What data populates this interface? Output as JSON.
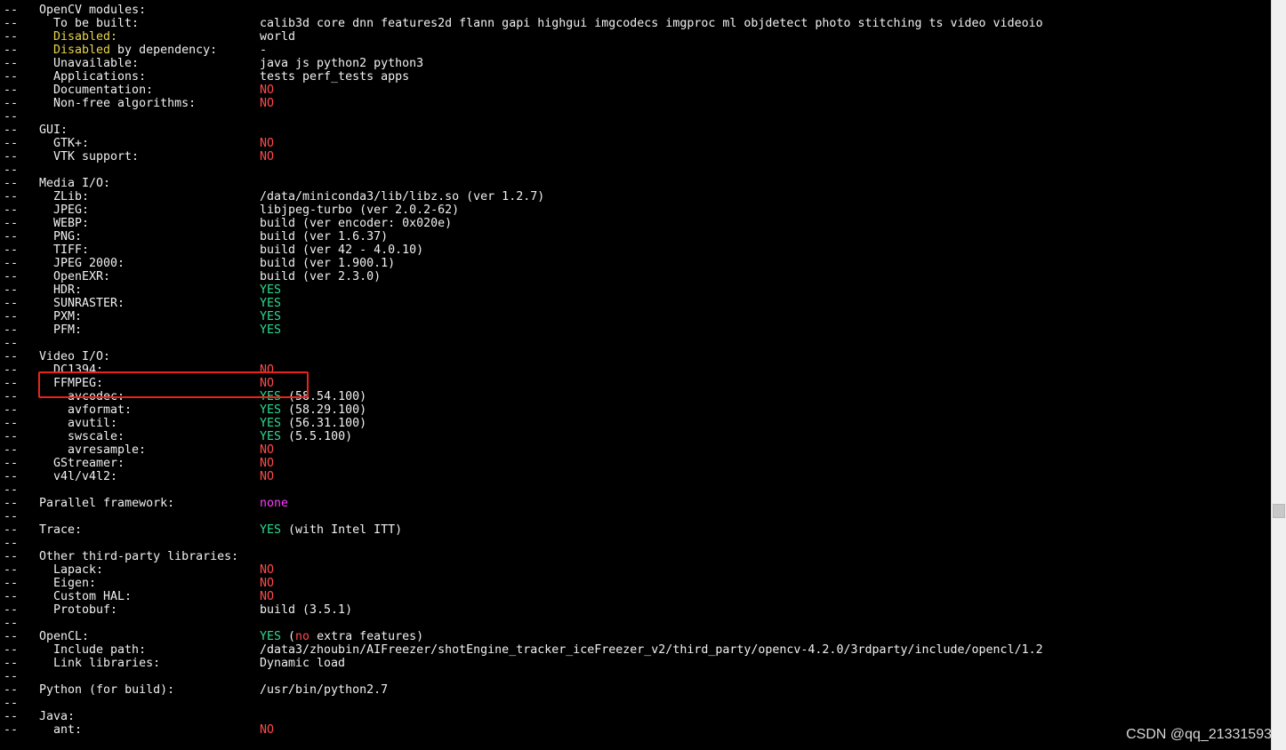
{
  "terminal": {
    "prefix": "--",
    "lines": [
      {
        "label": "OpenCV modules:",
        "indent": 1,
        "value": []
      },
      {
        "label": "To be built:",
        "indent": 2,
        "value": [
          {
            "t": "calib3d core dnn features2d flann gapi highgui imgcodecs imgproc ml objdetect photo stitching ts video videoio",
            "c": "white"
          }
        ]
      },
      {
        "labelParts": [
          {
            "t": "Disabled:",
            "c": "yellow"
          }
        ],
        "indent": 2,
        "value": [
          {
            "t": "world",
            "c": "white"
          }
        ]
      },
      {
        "labelParts": [
          {
            "t": "Disabled",
            "c": "yellow"
          },
          {
            "t": " by dependency:",
            "c": "white"
          }
        ],
        "indent": 2,
        "value": [
          {
            "t": "-",
            "c": "white"
          }
        ]
      },
      {
        "label": "Unavailable:",
        "indent": 2,
        "value": [
          {
            "t": "java js python2 python3",
            "c": "white"
          }
        ]
      },
      {
        "label": "Applications:",
        "indent": 2,
        "value": [
          {
            "t": "tests perf_tests apps",
            "c": "white"
          }
        ]
      },
      {
        "label": "Documentation:",
        "indent": 2,
        "value": [
          {
            "t": "NO",
            "c": "red"
          }
        ]
      },
      {
        "label": "Non-free algorithms:",
        "indent": 2,
        "value": [
          {
            "t": "NO",
            "c": "red"
          }
        ]
      },
      {
        "label": "",
        "indent": 0,
        "value": []
      },
      {
        "label": "GUI:",
        "indent": 1,
        "value": []
      },
      {
        "label": "GTK+:",
        "indent": 2,
        "value": [
          {
            "t": "NO",
            "c": "red"
          }
        ]
      },
      {
        "label": "VTK support:",
        "indent": 2,
        "value": [
          {
            "t": "NO",
            "c": "red"
          }
        ]
      },
      {
        "label": "",
        "indent": 0,
        "value": []
      },
      {
        "label": "Media I/O:",
        "indent": 1,
        "value": []
      },
      {
        "label": "ZLib:",
        "indent": 2,
        "value": [
          {
            "t": "/data/miniconda3/lib/libz.so (ver 1.2.7)",
            "c": "white"
          }
        ]
      },
      {
        "label": "JPEG:",
        "indent": 2,
        "value": [
          {
            "t": "libjpeg-turbo (ver 2.0.2-62)",
            "c": "white"
          }
        ]
      },
      {
        "label": "WEBP:",
        "indent": 2,
        "value": [
          {
            "t": "build (ver encoder: 0x020e)",
            "c": "white"
          }
        ]
      },
      {
        "label": "PNG:",
        "indent": 2,
        "value": [
          {
            "t": "build (ver 1.6.37)",
            "c": "white"
          }
        ]
      },
      {
        "label": "TIFF:",
        "indent": 2,
        "value": [
          {
            "t": "build (ver 42 - 4.0.10)",
            "c": "white"
          }
        ]
      },
      {
        "label": "JPEG 2000:",
        "indent": 2,
        "value": [
          {
            "t": "build (ver 1.900.1)",
            "c": "white"
          }
        ]
      },
      {
        "label": "OpenEXR:",
        "indent": 2,
        "value": [
          {
            "t": "build (ver 2.3.0)",
            "c": "white"
          }
        ]
      },
      {
        "label": "HDR:",
        "indent": 2,
        "value": [
          {
            "t": "YES",
            "c": "green"
          }
        ]
      },
      {
        "label": "SUNRASTER:",
        "indent": 2,
        "value": [
          {
            "t": "YES",
            "c": "green"
          }
        ]
      },
      {
        "label": "PXM:",
        "indent": 2,
        "value": [
          {
            "t": "YES",
            "c": "green"
          }
        ]
      },
      {
        "label": "PFM:",
        "indent": 2,
        "value": [
          {
            "t": "YES",
            "c": "green"
          }
        ]
      },
      {
        "label": "",
        "indent": 0,
        "value": []
      },
      {
        "label": "Video I/O:",
        "indent": 1,
        "value": []
      },
      {
        "label": "DC1394:",
        "indent": 2,
        "value": [
          {
            "t": "NO",
            "c": "red"
          }
        ]
      },
      {
        "label": "FFMPEG:",
        "indent": 2,
        "value": [
          {
            "t": "NO",
            "c": "red"
          }
        ]
      },
      {
        "label": "avcodec:",
        "indent": 3,
        "value": [
          {
            "t": "YES",
            "c": "green"
          },
          {
            "t": " (58.54.100)",
            "c": "white"
          }
        ]
      },
      {
        "label": "avformat:",
        "indent": 3,
        "value": [
          {
            "t": "YES",
            "c": "green"
          },
          {
            "t": " (58.29.100)",
            "c": "white"
          }
        ]
      },
      {
        "label": "avutil:",
        "indent": 3,
        "value": [
          {
            "t": "YES",
            "c": "green"
          },
          {
            "t": " (56.31.100)",
            "c": "white"
          }
        ]
      },
      {
        "label": "swscale:",
        "indent": 3,
        "value": [
          {
            "t": "YES",
            "c": "green"
          },
          {
            "t": " (5.5.100)",
            "c": "white"
          }
        ]
      },
      {
        "label": "avresample:",
        "indent": 3,
        "value": [
          {
            "t": "NO",
            "c": "red"
          }
        ]
      },
      {
        "label": "GStreamer:",
        "indent": 2,
        "value": [
          {
            "t": "NO",
            "c": "red"
          }
        ]
      },
      {
        "label": "v4l/v4l2:",
        "indent": 2,
        "value": [
          {
            "t": "NO",
            "c": "red"
          }
        ]
      },
      {
        "label": "",
        "indent": 0,
        "value": []
      },
      {
        "label": "Parallel framework:",
        "indent": 1,
        "value": [
          {
            "t": "none",
            "c": "magenta"
          }
        ]
      },
      {
        "label": "",
        "indent": 0,
        "value": []
      },
      {
        "label": "Trace:",
        "indent": 1,
        "value": [
          {
            "t": "YES",
            "c": "green"
          },
          {
            "t": " (with Intel ITT)",
            "c": "white"
          }
        ]
      },
      {
        "label": "",
        "indent": 0,
        "value": []
      },
      {
        "label": "Other third-party libraries:",
        "indent": 1,
        "value": []
      },
      {
        "label": "Lapack:",
        "indent": 2,
        "value": [
          {
            "t": "NO",
            "c": "red"
          }
        ]
      },
      {
        "label": "Eigen:",
        "indent": 2,
        "value": [
          {
            "t": "NO",
            "c": "red"
          }
        ]
      },
      {
        "label": "Custom HAL:",
        "indent": 2,
        "value": [
          {
            "t": "NO",
            "c": "red"
          }
        ]
      },
      {
        "label": "Protobuf:",
        "indent": 2,
        "value": [
          {
            "t": "build (3.5.1)",
            "c": "white"
          }
        ]
      },
      {
        "label": "",
        "indent": 0,
        "value": []
      },
      {
        "label": "OpenCL:",
        "indent": 1,
        "value": [
          {
            "t": "YES",
            "c": "green"
          },
          {
            "t": " (",
            "c": "white"
          },
          {
            "t": "no",
            "c": "red"
          },
          {
            "t": " extra features)",
            "c": "white"
          }
        ]
      },
      {
        "label": "Include path:",
        "indent": 2,
        "value": [
          {
            "t": "/data3/zhoubin/AIFreezer/shotEngine_tracker_iceFreezer_v2/third_party/opencv-4.2.0/3rdparty/include/opencl/1.2",
            "c": "white"
          }
        ]
      },
      {
        "label": "Link libraries:",
        "indent": 2,
        "value": [
          {
            "t": "Dynamic load",
            "c": "white"
          }
        ]
      },
      {
        "label": "",
        "indent": 0,
        "value": []
      },
      {
        "label": "Python (for build):",
        "indent": 1,
        "value": [
          {
            "t": "/usr/bin/python2.7",
            "c": "white"
          }
        ]
      },
      {
        "label": "",
        "indent": 0,
        "value": []
      },
      {
        "label": "Java:",
        "indent": 1,
        "value": []
      },
      {
        "label": "ant:",
        "indent": 2,
        "value": [
          {
            "t": "NO",
            "c": "red"
          }
        ]
      }
    ]
  },
  "colors": {
    "background": "#000000",
    "text": "#f0f0f0",
    "yes": "#2bdb8f",
    "no": "#ff4b4b",
    "disabled": "#e8d44d",
    "none": "#ff3cff",
    "highlight": "#e8231e"
  },
  "watermark": "CSDN @qq_21331593"
}
